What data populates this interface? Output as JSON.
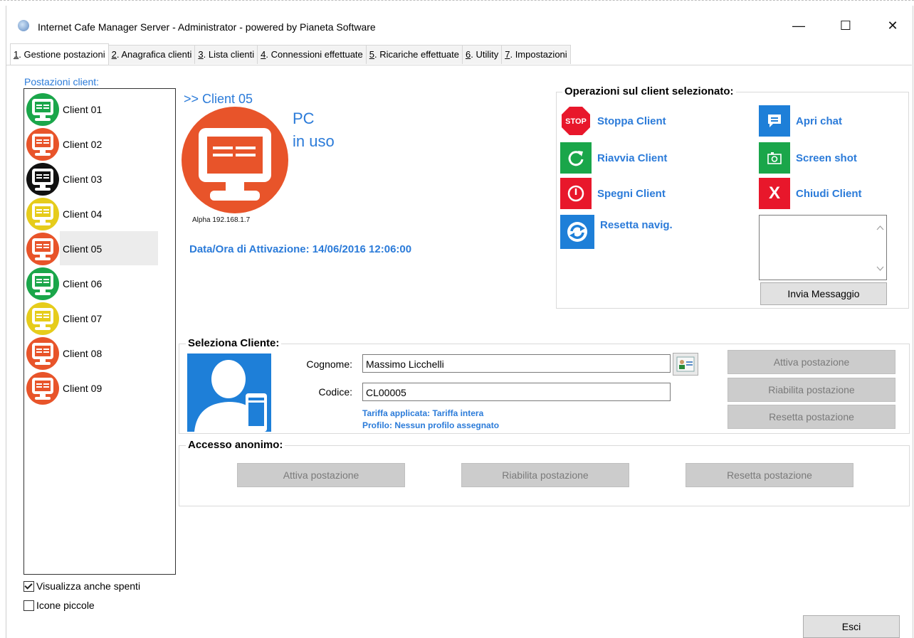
{
  "window": {
    "title": "Internet Cafe Manager Server - Administrator - powered by Pianeta Software",
    "minimize_glyph": "—",
    "maximize_glyph": "☐",
    "close_glyph": "✕"
  },
  "tabs": [
    {
      "num": "1",
      "label": ". Gestione postazioni",
      "active": true
    },
    {
      "num": "2",
      "label": ". Anagrafica clienti"
    },
    {
      "num": "3",
      "label": ". Lista clienti"
    },
    {
      "num": "4",
      "label": ". Connessioni effettuate"
    },
    {
      "num": "5",
      "label": ". Ricariche effettuate"
    },
    {
      "num": "6",
      "label": ". Utility"
    },
    {
      "num": "7",
      "label": ". Impostazioni"
    }
  ],
  "left": {
    "label": "Postazioni client:",
    "clients": [
      {
        "name": "Client 01",
        "color": "#1aa64a"
      },
      {
        "name": "Client 02",
        "color": "#e8542a"
      },
      {
        "name": "Client 03",
        "color": "#111111"
      },
      {
        "name": "Client 04",
        "color": "#e6cc1b"
      },
      {
        "name": "Client 05",
        "color": "#e8542a",
        "selected": true
      },
      {
        "name": "Client 06",
        "color": "#1aa64a"
      },
      {
        "name": "Client 07",
        "color": "#e6cc1b"
      },
      {
        "name": "Client 08",
        "color": "#e8542a"
      },
      {
        "name": "Client 09",
        "color": "#e8542a"
      }
    ],
    "show_off_label": "Visualizza anche spenti",
    "show_off_checked": true,
    "small_icons_label": "Icone piccole",
    "small_icons_checked": false
  },
  "detail": {
    "client_title": ">> Client 05",
    "status_line1": "PC",
    "status_line2": "in uso",
    "ip": "Alpha 192.168.1.7",
    "activation": "Data/Ora di Attivazione: 14/06/2016 12:06:00",
    "icon_color": "#e8542a"
  },
  "operations": {
    "title": "Operazioni sul client selezionato:",
    "stop": "Stoppa Client",
    "stop_icon_text": "STOP",
    "restart": "Riavvia Client",
    "shutdown": "Spegni Client",
    "reset_nav": "Resetta navig.",
    "chat": "Apri chat",
    "screenshot": "Screen shot",
    "close": "Chiudi Client",
    "close_icon_text": "X",
    "message_value": "",
    "send_message": "Invia Messaggio"
  },
  "select_client": {
    "title": "Seleziona Cliente:",
    "surname_label": "Cognome:",
    "surname_value": "Massimo Licchelli",
    "code_label": "Codice:",
    "code_value": "CL00005",
    "tariff": "Tariffa applicata: Tariffa intera",
    "profile": "Profilo: Nessun profilo assegnato",
    "activate": "Attiva postazione",
    "reenable": "Riabilita postazione",
    "reset": "Resetta postazione"
  },
  "anonymous": {
    "title": "Accesso anonimo:",
    "activate": "Attiva postazione",
    "reenable": "Riabilita postazione",
    "reset": "Resetta postazione"
  },
  "footer": {
    "exit": "Esci"
  },
  "colors": {
    "accent_blue": "#2b7bd9",
    "stop_red": "#e8172b",
    "green": "#1aa64a",
    "blue_tile": "#1e7fd8"
  }
}
